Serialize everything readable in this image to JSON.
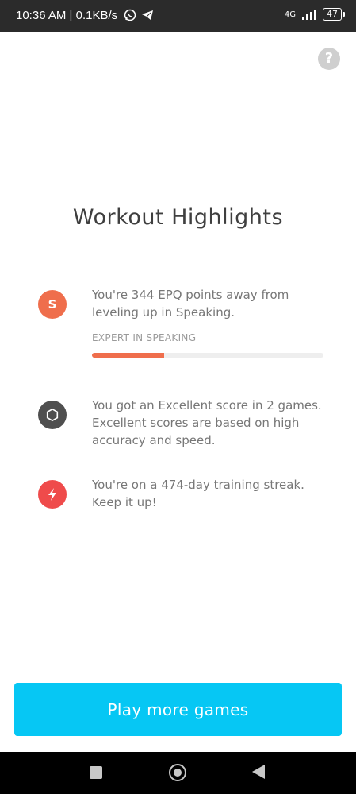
{
  "status_bar": {
    "time": "10:36 AM | 0.1KB/s",
    "network": "4G",
    "battery": "47"
  },
  "help": {
    "label": "?"
  },
  "title": "Workout Highlights",
  "highlights": [
    {
      "icon": "S",
      "color": "#ef6e4c",
      "text": "You're 344 EPQ points away from leveling up in Speaking.",
      "subhead": "EXPERT IN SPEAKING",
      "progress": 0.31
    },
    {
      "icon": "hexagon-icon",
      "color": "#4f4f4f",
      "text": "You got an Excellent score in 2 games. Excellent scores are based on high accuracy and speed."
    },
    {
      "icon": "lightning-icon",
      "color": "#ef4b4b",
      "text": "You're on a 474-day training streak. Keep it up!"
    }
  ],
  "cta": {
    "label": "Play more games",
    "color": "#06c7f4"
  }
}
